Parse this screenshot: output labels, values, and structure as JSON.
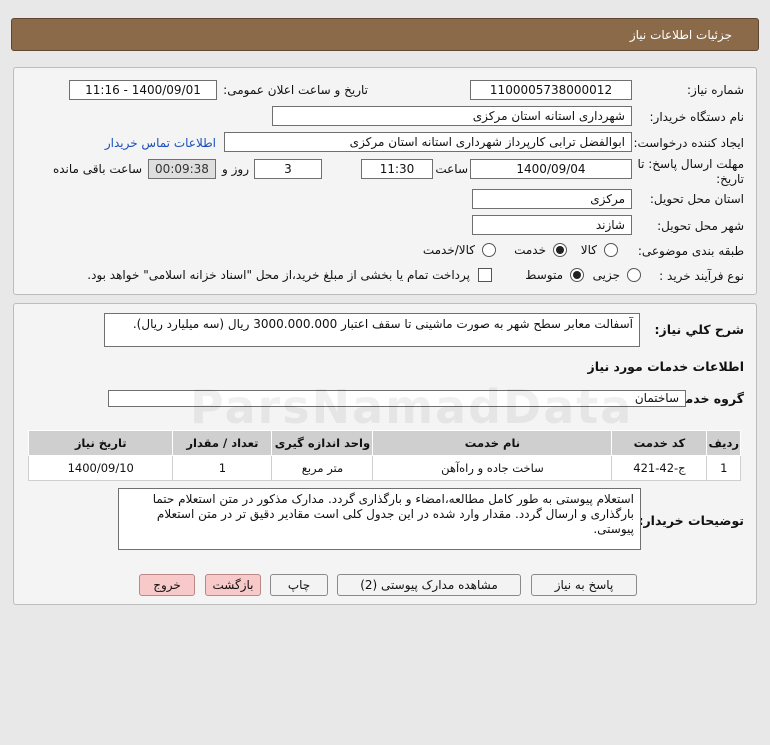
{
  "header": {
    "title": "جزئیات اطلاعات نیاز"
  },
  "form": {
    "need_number_label": "شماره نیاز:",
    "need_number": "1100005738000012",
    "announce_label": "تاریخ و ساعت اعلان عمومی:",
    "announce_value": "1400/09/01 - 11:16",
    "buyer_org_label": "نام دستگاه خریدار:",
    "buyer_org": "شهرداری استانه استان مرکزی",
    "requester_label": "ایجاد کننده درخواست:",
    "requester": "ابوالفضل  ترابی  کارپرداز  شهرداری استانه استان مرکزی",
    "contact_link": "اطلاعات تماس خریدار",
    "deadline_label_1": "مهلت ارسال پاسخ: تا",
    "deadline_label_2": "تاریخ:",
    "deadline_date": "1400/09/04",
    "time_label": "ساعت",
    "deadline_time": "11:30",
    "days_value": "3",
    "days_label": "روز و",
    "remaining_time": "00:09:38",
    "remaining_label": "ساعت باقی مانده",
    "province_label": "استان محل تحویل:",
    "province": "مرکزی",
    "city_label": "شهر محل تحویل:",
    "city": "شازند",
    "category_label": "طبقه بندی موضوعی:",
    "category_options": [
      "کالا",
      "خدمت",
      "کالا/خدمت"
    ],
    "category_selected": "خدمت",
    "process_label": "نوع فرآیند خرید :",
    "process_options": [
      "جزیی",
      "متوسط"
    ],
    "process_selected": "متوسط",
    "payment_note": "پرداخت تمام یا بخشی از مبلغ خرید،از محل \"اسناد خزانه اسلامی\" خواهد بود."
  },
  "description": {
    "label": "شرح کلي نياز:",
    "text": "آسفالت معابر سطح شهر به صورت ماشینی تا سقف اعتبار 3000.000.000 ریال (سه میلیارد ریال)."
  },
  "services": {
    "section_title": "اطلاعات خدمات مورد نیاز",
    "group_label": "گروه خدمت:",
    "group_value": "ساختمان",
    "columns": [
      "ردیف",
      "کد خدمت",
      "نام خدمت",
      "واحد اندازه گیری",
      "تعداد / مقدار",
      "تاریخ نیاز"
    ],
    "rows": [
      {
        "row": "1",
        "code": "ج-42-421",
        "name": "ساخت جاده و راه‌آهن",
        "unit": "متر مربع",
        "qty": "1",
        "date": "1400/09/10"
      }
    ]
  },
  "buyer_notes": {
    "label": "توضیحات خریدار:",
    "text": "استعلام پیوستی به طور کامل مطالعه،امضاء و بارگذاری گردد. مدارک مذکور در متن استعلام حتما بارگذاری و ارسال گردد. مقدار وارد شده در این جدول کلی است مقادیر دقیق تر در متن استعلام پیوستی."
  },
  "buttons": {
    "respond": "پاسخ به نیاز",
    "attachments": "مشاهده مدارک پیوستی (2)",
    "print": "چاپ",
    "back": "بازگشت",
    "exit": "خروج"
  },
  "watermark": "ParsNamadData"
}
